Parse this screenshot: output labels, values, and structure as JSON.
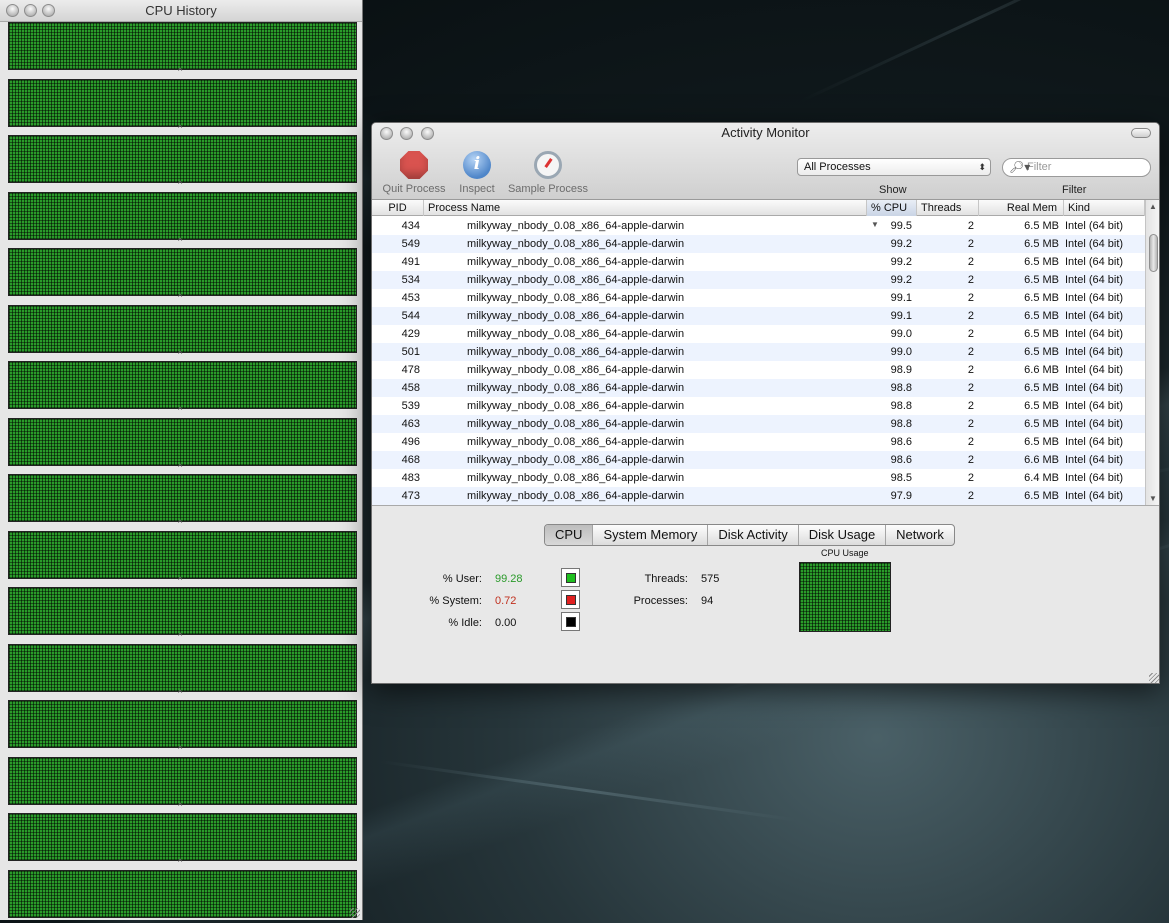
{
  "history_window": {
    "title": "CPU History",
    "graph_count": 16
  },
  "am": {
    "title": "Activity Monitor",
    "toolbar": {
      "quit_label": "Quit Process",
      "inspect_label": "Inspect",
      "sample_label": "Sample Process",
      "show_label": "Show",
      "filter_label": "Filter",
      "process_filter_value": "All Processes",
      "search_placeholder": "Filter"
    },
    "columns": {
      "pid": "PID",
      "name": "Process Name",
      "cpu": "% CPU",
      "threads": "Threads",
      "mem": "Real Mem",
      "kind": "Kind"
    },
    "rows": [
      {
        "pid": "434",
        "name": "milkyway_nbody_0.08_x86_64-apple-darwin",
        "cpu": "99.5",
        "threads": "2",
        "mem": "6.5 MB",
        "kind": "Intel (64 bit)"
      },
      {
        "pid": "549",
        "name": "milkyway_nbody_0.08_x86_64-apple-darwin",
        "cpu": "99.2",
        "threads": "2",
        "mem": "6.5 MB",
        "kind": "Intel (64 bit)"
      },
      {
        "pid": "491",
        "name": "milkyway_nbody_0.08_x86_64-apple-darwin",
        "cpu": "99.2",
        "threads": "2",
        "mem": "6.5 MB",
        "kind": "Intel (64 bit)"
      },
      {
        "pid": "534",
        "name": "milkyway_nbody_0.08_x86_64-apple-darwin",
        "cpu": "99.2",
        "threads": "2",
        "mem": "6.5 MB",
        "kind": "Intel (64 bit)"
      },
      {
        "pid": "453",
        "name": "milkyway_nbody_0.08_x86_64-apple-darwin",
        "cpu": "99.1",
        "threads": "2",
        "mem": "6.5 MB",
        "kind": "Intel (64 bit)"
      },
      {
        "pid": "544",
        "name": "milkyway_nbody_0.08_x86_64-apple-darwin",
        "cpu": "99.1",
        "threads": "2",
        "mem": "6.5 MB",
        "kind": "Intel (64 bit)"
      },
      {
        "pid": "429",
        "name": "milkyway_nbody_0.08_x86_64-apple-darwin",
        "cpu": "99.0",
        "threads": "2",
        "mem": "6.5 MB",
        "kind": "Intel (64 bit)"
      },
      {
        "pid": "501",
        "name": "milkyway_nbody_0.08_x86_64-apple-darwin",
        "cpu": "99.0",
        "threads": "2",
        "mem": "6.5 MB",
        "kind": "Intel (64 bit)"
      },
      {
        "pid": "478",
        "name": "milkyway_nbody_0.08_x86_64-apple-darwin",
        "cpu": "98.9",
        "threads": "2",
        "mem": "6.6 MB",
        "kind": "Intel (64 bit)"
      },
      {
        "pid": "458",
        "name": "milkyway_nbody_0.08_x86_64-apple-darwin",
        "cpu": "98.8",
        "threads": "2",
        "mem": "6.5 MB",
        "kind": "Intel (64 bit)"
      },
      {
        "pid": "539",
        "name": "milkyway_nbody_0.08_x86_64-apple-darwin",
        "cpu": "98.8",
        "threads": "2",
        "mem": "6.5 MB",
        "kind": "Intel (64 bit)"
      },
      {
        "pid": "463",
        "name": "milkyway_nbody_0.08_x86_64-apple-darwin",
        "cpu": "98.8",
        "threads": "2",
        "mem": "6.5 MB",
        "kind": "Intel (64 bit)"
      },
      {
        "pid": "496",
        "name": "milkyway_nbody_0.08_x86_64-apple-darwin",
        "cpu": "98.6",
        "threads": "2",
        "mem": "6.5 MB",
        "kind": "Intel (64 bit)"
      },
      {
        "pid": "468",
        "name": "milkyway_nbody_0.08_x86_64-apple-darwin",
        "cpu": "98.6",
        "threads": "2",
        "mem": "6.6 MB",
        "kind": "Intel (64 bit)"
      },
      {
        "pid": "483",
        "name": "milkyway_nbody_0.08_x86_64-apple-darwin",
        "cpu": "98.5",
        "threads": "2",
        "mem": "6.4 MB",
        "kind": "Intel (64 bit)"
      },
      {
        "pid": "473",
        "name": "milkyway_nbody_0.08_x86_64-apple-darwin",
        "cpu": "97.9",
        "threads": "2",
        "mem": "6.5 MB",
        "kind": "Intel (64 bit)"
      }
    ],
    "tabs": [
      "CPU",
      "System Memory",
      "Disk Activity",
      "Disk Usage",
      "Network"
    ],
    "active_tab": "CPU",
    "stats": {
      "user_label": "% User:",
      "user_value": "99.28",
      "system_label": "% System:",
      "system_value": "0.72",
      "idle_label": "% Idle:",
      "idle_value": "0.00",
      "threads_label": "Threads:",
      "threads_value": "575",
      "processes_label": "Processes:",
      "processes_value": "94",
      "usage_title": "CPU Usage"
    },
    "colors": {
      "user": "#1fbf1f",
      "system": "#e02020",
      "idle": "#000000",
      "user_text": "#2a9a2a",
      "system_text": "#c0301e",
      "graph_green": "#2a9b2a"
    }
  }
}
